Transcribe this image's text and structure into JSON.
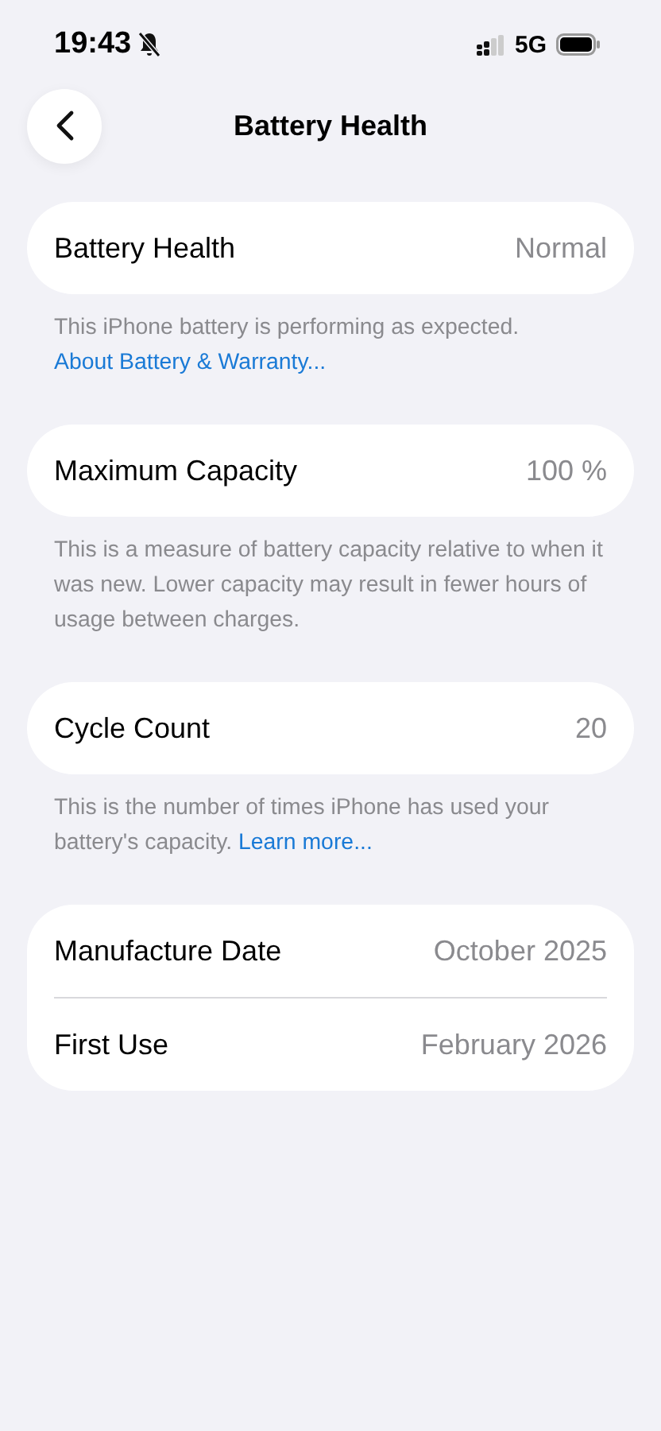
{
  "status_bar": {
    "time": "19:43",
    "network": "5G"
  },
  "nav": {
    "title": "Battery Health"
  },
  "groups": [
    {
      "rows": [
        {
          "label": "Battery Health",
          "value": "Normal"
        }
      ],
      "footer": {
        "text": "This iPhone battery is performing as expected.",
        "link": "About Battery & Warranty..."
      }
    },
    {
      "rows": [
        {
          "label": "Maximum Capacity",
          "value": "100 %"
        }
      ],
      "footer": {
        "text": "This is a measure of battery capacity relative to when it was new. Lower capacity may result in fewer hours of usage between charges."
      }
    },
    {
      "rows": [
        {
          "label": "Cycle Count",
          "value": "20"
        }
      ],
      "footer": {
        "text": "This is the number of times iPhone has used your battery's capacity.",
        "link": "Learn more..."
      }
    },
    {
      "rows": [
        {
          "label": "Manufacture Date",
          "value": "October 2025"
        },
        {
          "label": "First Use",
          "value": "February 2026"
        }
      ]
    }
  ]
}
